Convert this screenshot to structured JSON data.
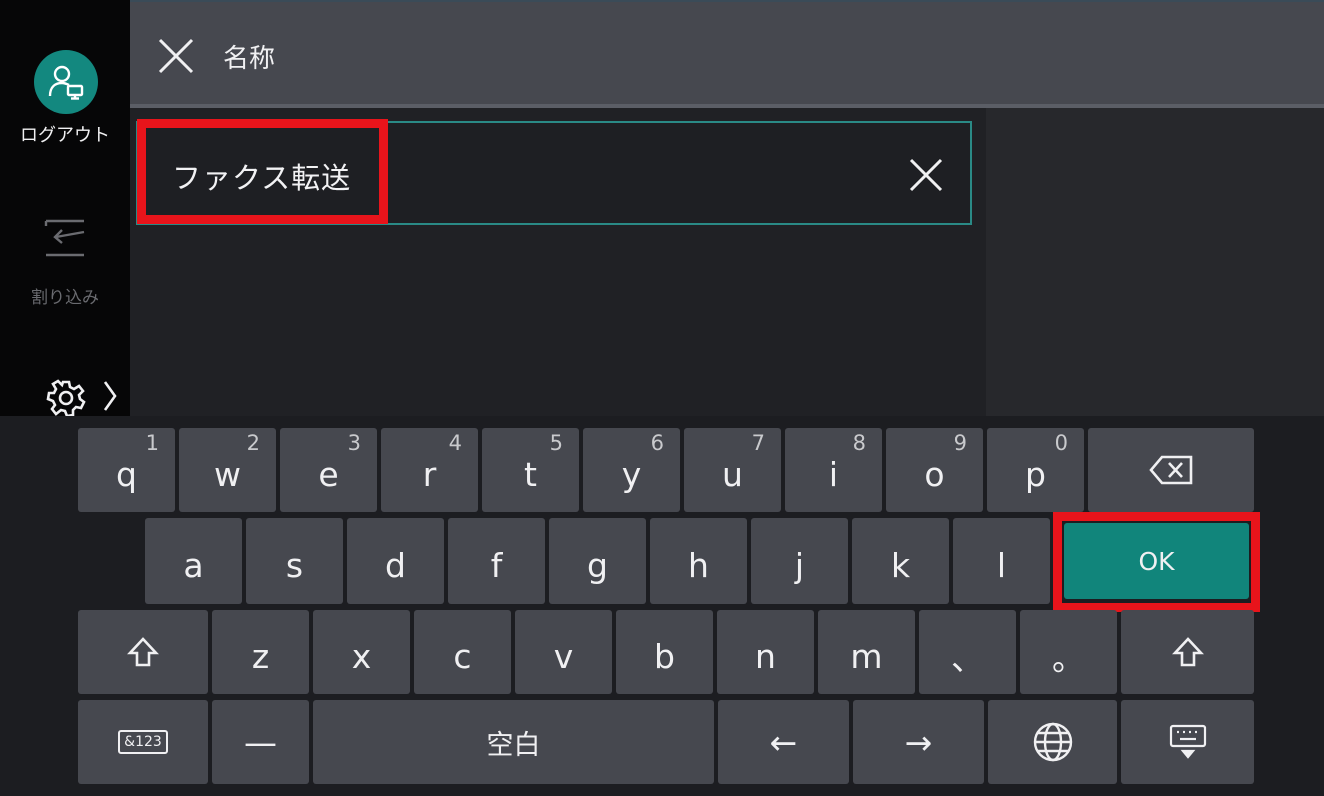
{
  "header": {
    "title": "名称"
  },
  "sidebar": {
    "logout_label": "ログアウト",
    "interrupt_label": "割り込み"
  },
  "input": {
    "value": "ファクス転送"
  },
  "keyboard": {
    "row1": [
      {
        "label": "q",
        "num": "1"
      },
      {
        "label": "w",
        "num": "2"
      },
      {
        "label": "e",
        "num": "3"
      },
      {
        "label": "r",
        "num": "4"
      },
      {
        "label": "t",
        "num": "5"
      },
      {
        "label": "y",
        "num": "6"
      },
      {
        "label": "u",
        "num": "7"
      },
      {
        "label": "i",
        "num": "8"
      },
      {
        "label": "o",
        "num": "9"
      },
      {
        "label": "p",
        "num": "0"
      }
    ],
    "row2": [
      "a",
      "s",
      "d",
      "f",
      "g",
      "h",
      "j",
      "k",
      "l"
    ],
    "row3": [
      "z",
      "x",
      "c",
      "v",
      "b",
      "n",
      "m",
      "、",
      "。"
    ],
    "ok_label": "OK",
    "space_label": "空白",
    "mode_label": "&123",
    "dash_label": "—",
    "left_label": "←",
    "right_label": "→"
  },
  "colors": {
    "accent": "#11857b",
    "highlight": "#e8141b",
    "input_border": "#2a8a86"
  }
}
